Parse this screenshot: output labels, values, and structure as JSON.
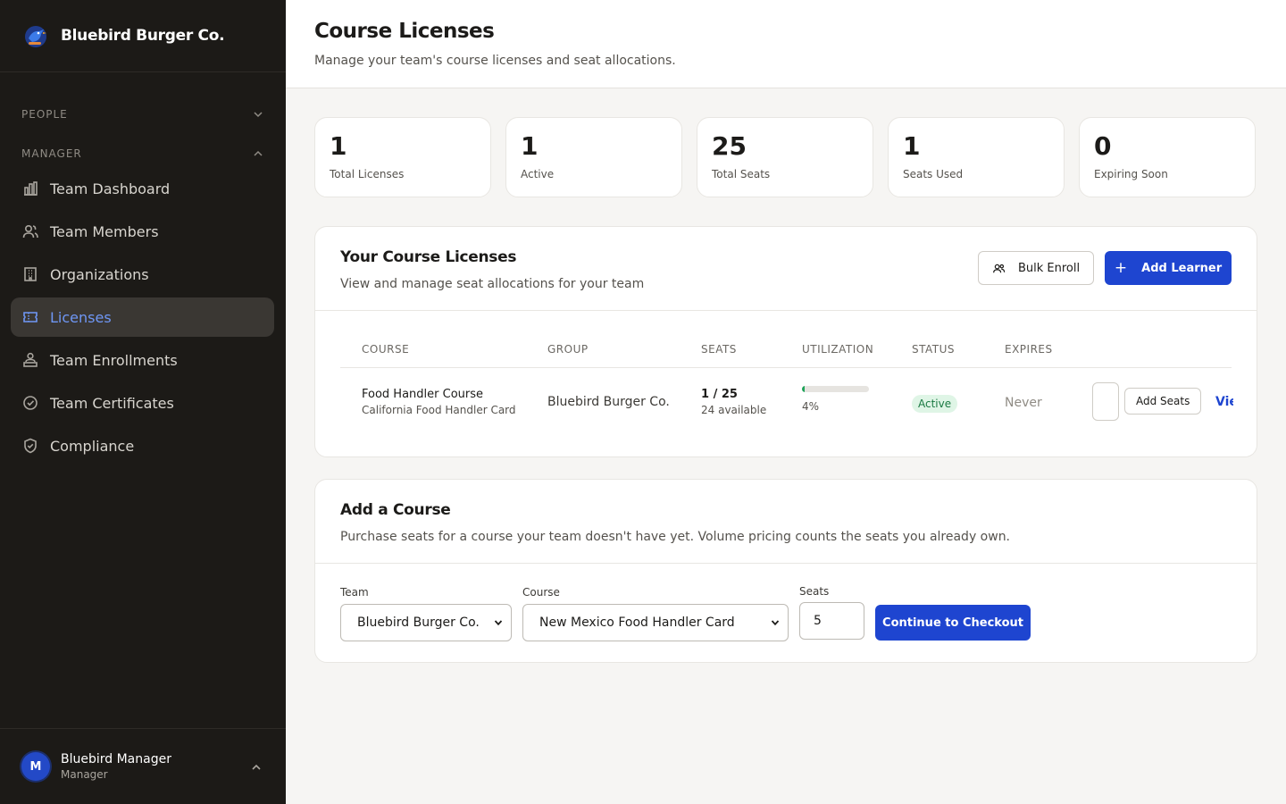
{
  "brand": {
    "name": "Bluebird Burger Co."
  },
  "sidebar": {
    "sections": [
      {
        "label": "PEOPLE",
        "expanded": false
      },
      {
        "label": "MANAGER",
        "expanded": true
      }
    ],
    "items": [
      {
        "label": "Team Dashboard",
        "icon": "bar-chart-icon",
        "active": false
      },
      {
        "label": "Team Members",
        "icon": "users-icon",
        "active": false
      },
      {
        "label": "Organizations",
        "icon": "building-icon",
        "active": false
      },
      {
        "label": "Licenses",
        "icon": "ticket-icon",
        "active": true
      },
      {
        "label": "Team Enrollments",
        "icon": "enroll-icon",
        "active": false
      },
      {
        "label": "Team Certificates",
        "icon": "badge-check-icon",
        "active": false
      },
      {
        "label": "Compliance",
        "icon": "shield-check-icon",
        "active": false
      }
    ],
    "user": {
      "initial": "M",
      "name": "Bluebird Manager",
      "role": "Manager"
    }
  },
  "header": {
    "title": "Course Licenses",
    "subtitle": "Manage your team's course licenses and seat allocations."
  },
  "stats": [
    {
      "value": "1",
      "label": "Total Licenses"
    },
    {
      "value": "1",
      "label": "Active"
    },
    {
      "value": "25",
      "label": "Total Seats"
    },
    {
      "value": "1",
      "label": "Seats Used"
    },
    {
      "value": "0",
      "label": "Expiring Soon"
    }
  ],
  "licenses": {
    "title": "Your Course Licenses",
    "subtitle": "View and manage seat allocations for your team",
    "bulk_enroll_label": "Bulk Enroll",
    "add_learner_label": "Add Learner",
    "columns": [
      "COURSE",
      "GROUP",
      "SEATS",
      "UTILIZATION",
      "STATUS",
      "EXPIRES"
    ],
    "rows": [
      {
        "course": "Food Handler Course",
        "course_sub": "California Food Handler Card",
        "group": "Bluebird Burger Co.",
        "seats": "1 / 25",
        "available": "24 available",
        "utilization_pct": 4,
        "utilization_label": "4%",
        "status": "Active",
        "expires": "Never",
        "add_seats_label": "Add Seats",
        "view_label": "View"
      }
    ]
  },
  "add_course": {
    "title": "Add a Course",
    "subtitle": "Purchase seats for a course your team doesn't have yet. Volume pricing counts the seats you already own.",
    "team_label": "Team",
    "team_value": "Bluebird Burger Co.",
    "course_label": "Course",
    "course_value": "New Mexico Food Handler Card",
    "seats_label": "Seats",
    "seats_value": "5",
    "checkout_label": "Continue to Checkout"
  },
  "colors": {
    "accent": "#1e45d0",
    "sidebar_bg": "#1c1a17",
    "active_text": "#6f97f5",
    "success": "#1fa35a"
  }
}
